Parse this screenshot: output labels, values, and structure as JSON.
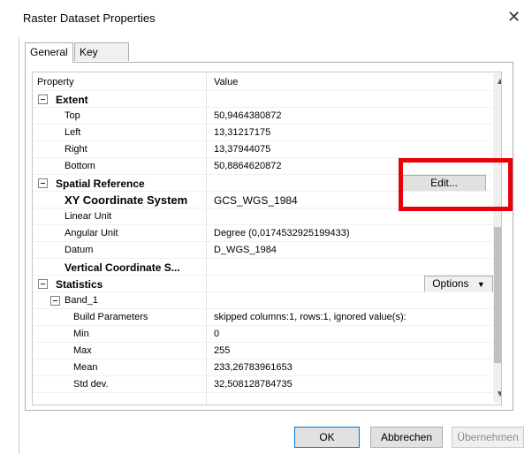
{
  "window": {
    "title": "Raster Dataset Properties",
    "close_glyph": "✕"
  },
  "tabs": [
    {
      "label": "General",
      "active": true
    },
    {
      "label": "Key Metadata",
      "active": false
    }
  ],
  "grid": {
    "header": {
      "property": "Property",
      "value": "Value"
    },
    "rows": {
      "extent": {
        "label": "Extent",
        "expand": "minus"
      },
      "top": {
        "label": "Top",
        "value": "50,9464380872"
      },
      "left": {
        "label": "Left",
        "value": "13,31217175"
      },
      "right": {
        "label": "Right",
        "value": "13,37944075"
      },
      "bottom": {
        "label": "Bottom",
        "value": "50,8864620872"
      },
      "spatial": {
        "label": "Spatial Reference",
        "button": "Edit..."
      },
      "xy": {
        "label": "XY Coordinate System",
        "value": "GCS_WGS_1984"
      },
      "linear": {
        "label": "Linear Unit",
        "value": ""
      },
      "angular": {
        "label": "Angular Unit",
        "value": "Degree (0,0174532925199433)"
      },
      "datum": {
        "label": "Datum",
        "value": "D_WGS_1984"
      },
      "vertical": {
        "label": "Vertical Coordinate S...",
        "value": ""
      },
      "statistics": {
        "label": "Statistics",
        "button": "Options"
      },
      "band": {
        "label": "Band_1"
      },
      "build": {
        "label": "Build Parameters",
        "value": "skipped columns:1, rows:1, ignored value(s):"
      },
      "min": {
        "label": "Min",
        "value": "0"
      },
      "max": {
        "label": "Max",
        "value": "255"
      },
      "mean": {
        "label": "Mean",
        "value": "233,26783961653"
      },
      "std": {
        "label": "Std dev.",
        "value": "32,508128784735"
      }
    }
  },
  "footer": {
    "ok": "OK",
    "cancel": "Abbrechen",
    "apply": "Übernehmen"
  },
  "colors": {
    "highlight_box": "#e8000b",
    "button_bg": "#e1e1e1",
    "border": "#adadad"
  }
}
